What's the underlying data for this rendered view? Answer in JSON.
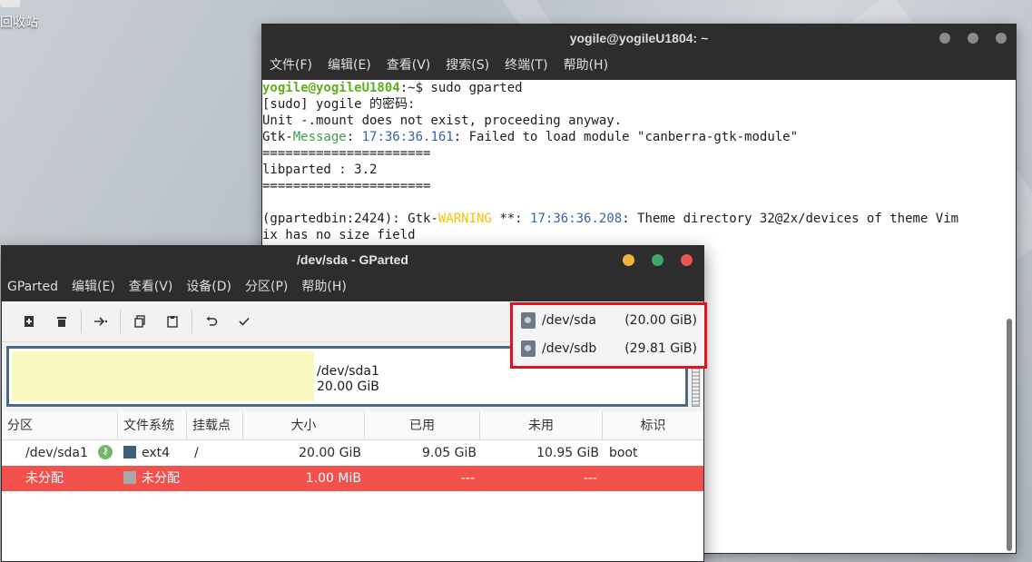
{
  "desktop": {
    "icon_label": "回收站"
  },
  "terminal": {
    "title": "yogile@yogileU1804: ~",
    "menu": [
      "文件(F)",
      "编辑(E)",
      "查看(V)",
      "搜索(S)",
      "终端(T)",
      "帮助(H)"
    ],
    "lines": {
      "l1_user": "yogile@yogileU1804",
      "l1_rest": ":~$ sudo gparted",
      "l2": "[sudo] yogile 的密码:",
      "l3": "Unit -.mount does not exist, proceeding anyway.",
      "l4_a": "Gtk-",
      "l4_b": "Message",
      "l4_c": ": ",
      "l4_time": "17:36:36.161",
      "l4_d": ": Failed to load module \"canberra-gtk-module\"",
      "l5": "======================",
      "l6": "libparted : 3.2",
      "l7": "======================",
      "l8": "",
      "l9_a": "(gpartedbin:2424): Gtk-",
      "l9_warn": "WARNING",
      "l9_b": " **: ",
      "l9_time": "17:36:36.208",
      "l9_c": ": Theme directory 32@2x/devices of theme Vim",
      "l10": "ix has no size field"
    }
  },
  "gparted": {
    "title": "/dev/sda - GParted",
    "menu": [
      "GParted",
      "编辑(E)",
      "查看(V)",
      "设备(D)",
      "分区(P)",
      "帮助(H)"
    ],
    "colors": {
      "close": "#e95651",
      "min": "#f0b43a",
      "max": "#3fa66a"
    },
    "devices": [
      {
        "name": "/dev/sda",
        "size": "(20.00 GiB)"
      },
      {
        "name": "/dev/sdb",
        "size": "(29.81 GiB)"
      }
    ],
    "partition_viz": {
      "name": "/dev/sda1",
      "size": "20.00 GiB"
    },
    "columns": [
      "分区",
      "文件系统",
      "挂载点",
      "大小",
      "已用",
      "未用",
      "标识"
    ],
    "rows": [
      {
        "partition": "/dev/sda1",
        "fs": "ext4",
        "mount": "/",
        "size": "20.00 GiB",
        "used": "9.05 GiB",
        "unused": "10.95 GiB",
        "flags": "boot",
        "fs_color": "#3c5f7a"
      },
      {
        "partition": "未分配",
        "fs": "未分配",
        "mount": "",
        "size": "1.00 MiB",
        "used": "---",
        "unused": "---",
        "flags": "",
        "fs_color": "#a8a8a8"
      }
    ]
  }
}
